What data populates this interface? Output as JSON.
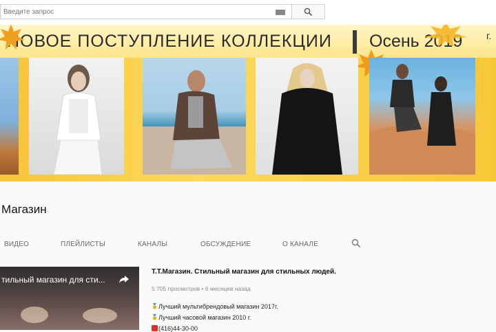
{
  "search": {
    "placeholder": "Введите запрос"
  },
  "banner": {
    "title": "НОВОЕ ПОСТУПЛЕНИЕ КОЛЛЕКЦИИ",
    "season": "Осень 2019",
    "edge_mark": "г."
  },
  "channel": {
    "name": "Магазин"
  },
  "tabs": [
    {
      "label": "ВИДЕО"
    },
    {
      "label": "ПЛЕЙЛИСТЫ"
    },
    {
      "label": "КАНАЛЫ"
    },
    {
      "label": "ОБСУЖДЕНИЕ"
    },
    {
      "label": "О КАНАЛЕ"
    }
  ],
  "video": {
    "thumb_title": "тильный магазин для сти...",
    "title": "Т.Т.Магазин. Стильный магазин для стильных людей.",
    "meta": "5 705 просмотров • 6 месяцев назад",
    "description": [
      "Лучший мультибрендовый магазин 2017г.",
      "Лучший часовой магазин 2010 г.",
      "(416)44-30-00"
    ]
  },
  "colors": {
    "banner_yellow": "#f8c739",
    "medal_gold": "#e8b320",
    "phone_red": "#d9302a"
  }
}
